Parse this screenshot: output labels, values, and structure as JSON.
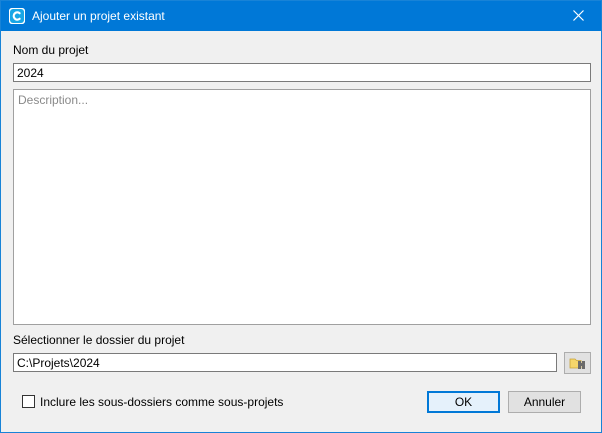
{
  "window": {
    "title": "Ajouter un projet existant",
    "accent_color": "#0078d7"
  },
  "form": {
    "project_name_label": "Nom du projet",
    "project_name_value": "2024",
    "description_placeholder": "Description...",
    "description_value": "",
    "folder_label": "Sélectionner le dossier du projet",
    "folder_value": "C:\\Projets\\2024",
    "include_subfolders_label": "Inclure les sous-dossiers comme sous-projets",
    "include_subfolders_checked": false
  },
  "buttons": {
    "ok_label": "OK",
    "cancel_label": "Annuler"
  },
  "icons": {
    "app": "app-logo-icon",
    "close": "close-icon",
    "browse": "folder-browse-icon"
  }
}
